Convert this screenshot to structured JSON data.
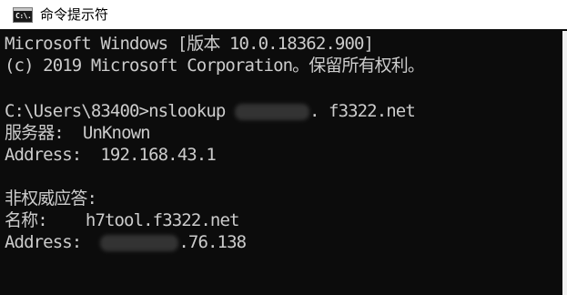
{
  "window": {
    "title": "命令提示符",
    "icon": "console-icon",
    "icon_glyph": "C:\\."
  },
  "console": {
    "header1": "Microsoft Windows [版本 10.0.18362.900]",
    "header2": "(c) 2019 Microsoft Corporation。保留所有权利。",
    "prompt": "C:\\Users\\83400>",
    "command": "nslookup ",
    "command_domain_suffix": ". f3322.net",
    "server_label": "服务器:  ",
    "server_value": "UnKnown",
    "address_label": "Address:  ",
    "address_value": "192.168.43.1",
    "nonauth_label": "非权威应答:",
    "name_label": "名称:    ",
    "name_value": "h7tool.f3322.net",
    "address2_label": "Address:  ",
    "address2_suffix": ".76.138"
  },
  "colors": {
    "console_bg": "#0c0c0c",
    "console_text": "#cccccc",
    "titlebar_bg": "#ffffff"
  }
}
